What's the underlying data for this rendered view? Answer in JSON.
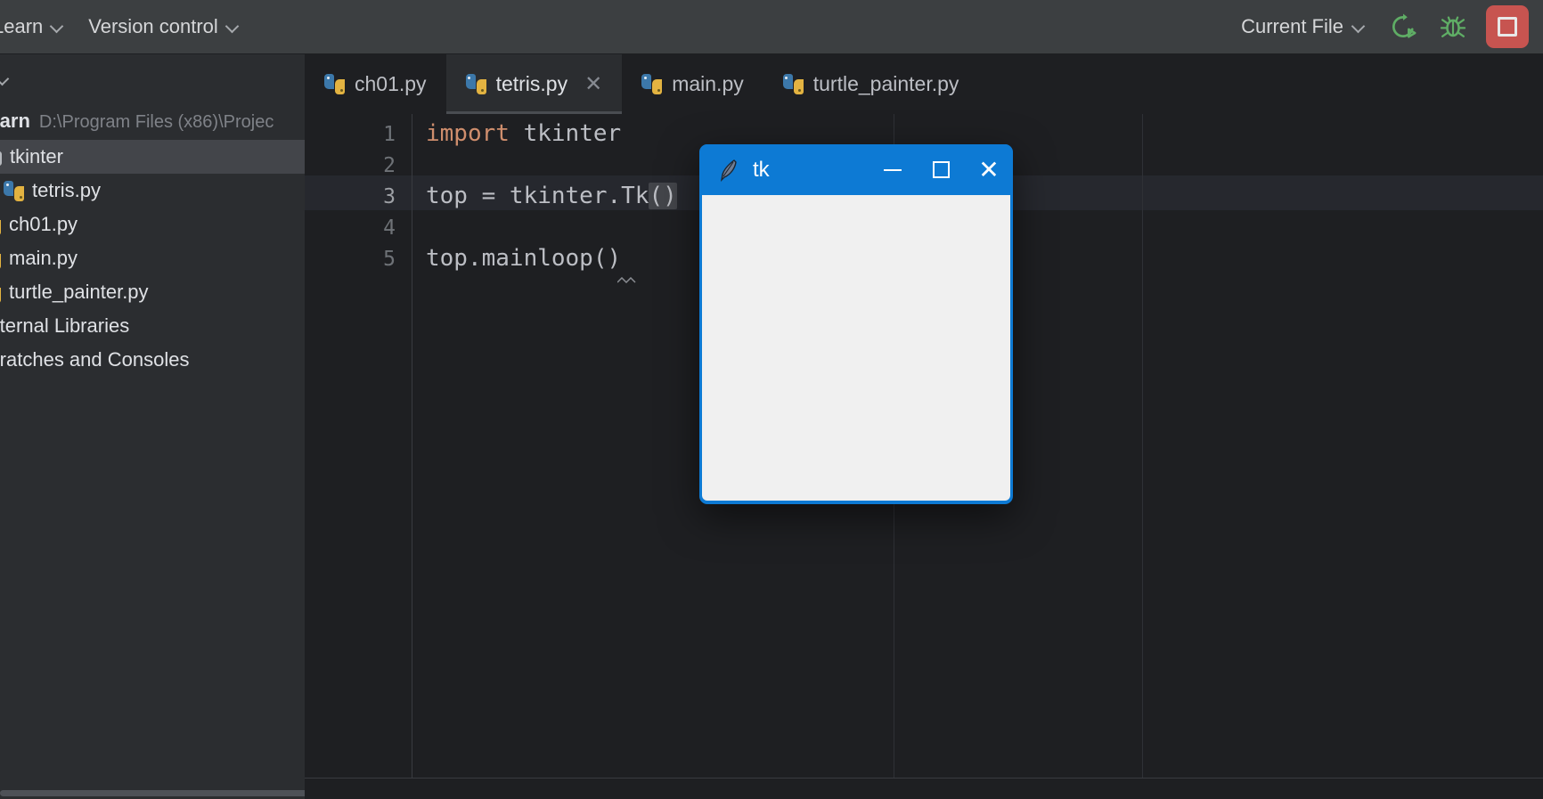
{
  "toolbar": {
    "menus": [
      {
        "label": "Learn",
        "icon": "chevron-down-icon"
      },
      {
        "label": "Version control",
        "icon": "chevron-down-icon"
      }
    ],
    "run_config": {
      "label": "Current File",
      "icon": "chevron-down-icon"
    },
    "run_icon": "rerun-icon",
    "debug_icon": "debug-bug-icon",
    "stop_icon": "stop-square-icon",
    "colors": {
      "run_green": "#59a869",
      "stop_red": "#c75450",
      "bar": "#3c3f41"
    }
  },
  "sidebar": {
    "header_icon": "chevron-down-icon",
    "project_root": {
      "name": "Learn",
      "path": "D:\\Program Files (x86)\\Projec"
    },
    "items": [
      {
        "label": "tkinter",
        "icon": "folder-icon",
        "indent": 0,
        "selected": true
      },
      {
        "label": "tetris.py",
        "icon": "python-file-icon",
        "indent": 1,
        "selected": false
      },
      {
        "label": "ch01.py",
        "icon": "python-file-icon",
        "indent": 0,
        "selected": false
      },
      {
        "label": "main.py",
        "icon": "python-file-icon",
        "indent": 0,
        "selected": false
      },
      {
        "label": "turtle_painter.py",
        "icon": "python-file-icon",
        "indent": 0,
        "selected": false
      },
      {
        "label": "External Libraries",
        "icon": "none",
        "indent": 0,
        "selected": false
      },
      {
        "label": "Scratches and Consoles",
        "icon": "none",
        "indent": 0,
        "selected": false
      }
    ]
  },
  "editor": {
    "tabs": [
      {
        "label": "ch01.py",
        "icon": "python-file-icon",
        "active": false,
        "closable": false
      },
      {
        "label": "tetris.py",
        "icon": "python-file-icon",
        "active": true,
        "closable": true,
        "close_icon": "close-icon"
      },
      {
        "label": "main.py",
        "icon": "python-file-icon",
        "active": false,
        "closable": false
      },
      {
        "label": "turtle_painter.py",
        "icon": "python-file-icon",
        "active": false,
        "closable": false
      }
    ],
    "line_numbers": [
      "1",
      "2",
      "3",
      "4",
      "5"
    ],
    "current_line": 3,
    "code": {
      "l1_kw": "import",
      "l1_rest": " tkinter",
      "l3_a": "top = tkinter.Tk",
      "l3_brackets": "()",
      "l5": "top.mainloop()"
    },
    "colors": {
      "background": "#1e1f22",
      "keyword": "#cf8e6d",
      "text": "#bcbec4",
      "current_line": "#26282e"
    }
  },
  "tk_window": {
    "title": "tk",
    "icon": "feather-icon",
    "minimize_icon": "minimize-icon",
    "maximize_icon": "maximize-icon",
    "close_icon": "close-icon",
    "colors": {
      "titlebar": "#0d7ad4",
      "body": "#f0f0f0"
    }
  }
}
